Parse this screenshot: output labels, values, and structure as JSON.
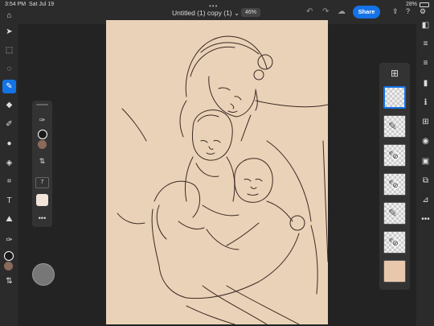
{
  "status_bar": {
    "time": "3:54 PM",
    "date": "Sat Jul 19",
    "battery": "28%",
    "more": "•••"
  },
  "document": {
    "title": "Untitled (1) copy (1)",
    "zoom": "46%",
    "chevron": "⌄"
  },
  "header": {
    "share_label": "Share"
  },
  "icons": {
    "home": "⌂",
    "undo": "↶",
    "redo": "↷",
    "cloud": "☁",
    "export": "⇪",
    "help": "?",
    "settings": "⚙",
    "select": "➤",
    "transform": "⬚",
    "lasso": "◌",
    "brush": "✎",
    "eraser": "◆",
    "smudge": "✐",
    "shape": "●",
    "fill": "◈",
    "crop": "⌗",
    "text": "T",
    "image": "⛰",
    "eyedropper": "✑",
    "swap": "⇅",
    "layers": "◧",
    "adjust": "≡",
    "comment": "▮",
    "info": "ℹ",
    "add": "⊞",
    "eye": "◉",
    "mask": "▣",
    "merge": "⧉",
    "clip": "⊿",
    "more": "•••"
  },
  "tool_panel": {
    "brush_size": "7"
  },
  "layers": [
    {
      "type": "blank",
      "selected": true
    },
    {
      "type": "sketch",
      "selected": false
    },
    {
      "type": "hidden",
      "selected": false
    },
    {
      "type": "hidden",
      "selected": false
    },
    {
      "type": "sketch",
      "selected": false
    },
    {
      "type": "hidden",
      "selected": false
    },
    {
      "type": "background",
      "selected": false
    }
  ],
  "colors": {
    "accent": "#1473e6",
    "canvas": "#ead2b8",
    "foreground": "#1a1a1a",
    "background_swatch": "#8a6a5a",
    "sketch_line": "#3b2a24"
  }
}
